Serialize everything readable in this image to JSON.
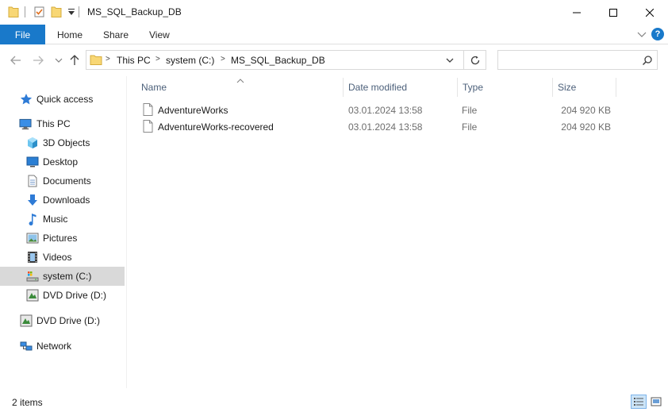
{
  "window": {
    "title": "MS_SQL_Backup_DB"
  },
  "ribbon": {
    "tabs": {
      "file": "File",
      "home": "Home",
      "share": "Share",
      "view": "View"
    },
    "help_label": "?"
  },
  "address": {
    "crumbs": [
      "This PC",
      "system (C:)",
      "MS_SQL_Backup_DB"
    ],
    "separator": ">"
  },
  "search": {
    "value": "",
    "placeholder": ""
  },
  "sidebar": {
    "items": [
      {
        "label": "Quick access",
        "icon": "star-icon"
      },
      {
        "label": "This PC",
        "icon": "computer-icon"
      },
      {
        "label": "3D Objects",
        "icon": "cube-icon"
      },
      {
        "label": "Desktop",
        "icon": "desktop-icon"
      },
      {
        "label": "Documents",
        "icon": "document-icon"
      },
      {
        "label": "Downloads",
        "icon": "download-arrow-icon"
      },
      {
        "label": "Music",
        "icon": "music-note-icon"
      },
      {
        "label": "Pictures",
        "icon": "picture-icon"
      },
      {
        "label": "Videos",
        "icon": "film-icon"
      },
      {
        "label": "system (C:)",
        "icon": "drive-icon",
        "selected": true
      },
      {
        "label": "DVD Drive (D:)",
        "icon": "dvd-drive-icon"
      },
      {
        "label": "DVD Drive (D:)",
        "icon": "dvd-drive-icon"
      },
      {
        "label": "Network",
        "icon": "network-icon"
      }
    ]
  },
  "filelist": {
    "columns": {
      "name": "Name",
      "date": "Date modified",
      "type": "Type",
      "size": "Size"
    },
    "sorted_by": "name",
    "rows": [
      {
        "name": "AdventureWorks",
        "date": "03.01.2024 13:58",
        "type": "File",
        "size": "204 920 KB"
      },
      {
        "name": "AdventureWorks-recovered",
        "date": "03.01.2024 13:58",
        "type": "File",
        "size": "204 920 KB"
      }
    ]
  },
  "status": {
    "item_count": "2 items"
  },
  "colors": {
    "accent": "#1979ca",
    "selected_bg": "#d9d9d9",
    "header_text": "#4c607a",
    "folder_yellow": "#f8d775"
  }
}
